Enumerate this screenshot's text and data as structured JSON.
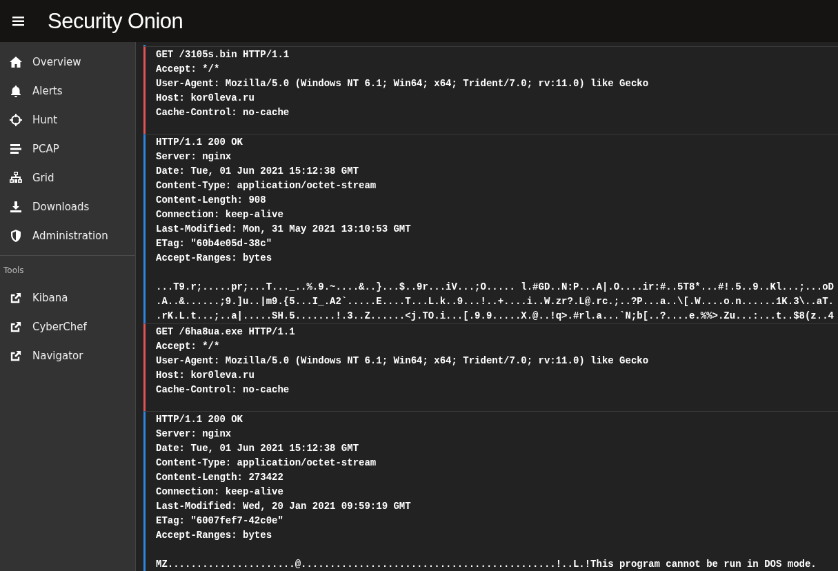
{
  "app": {
    "title": "Security Onion"
  },
  "nav": [
    {
      "label": "Overview"
    },
    {
      "label": "Alerts"
    },
    {
      "label": "Hunt"
    },
    {
      "label": "PCAP"
    },
    {
      "label": "Grid"
    },
    {
      "label": "Downloads"
    },
    {
      "label": "Administration"
    }
  ],
  "tools": {
    "heading": "Tools",
    "items": [
      {
        "label": "Kibana"
      },
      {
        "label": "CyberChef"
      },
      {
        "label": "Navigator"
      }
    ]
  },
  "stream": [
    {
      "kind": "response"
    },
    {
      "kind": "request",
      "headers": [
        "GET /3105s.bin HTTP/1.1",
        "Accept: */*",
        "User-Agent: Mozilla/5.0 (Windows NT 6.1; Win64; x64; Trident/7.0; rv:11.0) like Gecko",
        "Host: kor0leva.ru",
        "Cache-Control: no-cache"
      ]
    },
    {
      "kind": "response",
      "headers": [
        "HTTP/1.1 200 OK",
        "Server: nginx",
        "Date: Tue, 01 Jun 2021 15:12:38 GMT",
        "Content-Type: application/octet-stream",
        "Content-Length: 908",
        "Connection: keep-alive",
        "Last-Modified: Mon, 31 May 2021 13:10:53 GMT",
        "ETag: \"60b4e05d-38c\"",
        "Accept-Ranges: bytes"
      ],
      "body": [
        "...T9.r;.....pr;...T..._..%.9.~....&..}...$..9r...iV...;O..... l.#GD..N:P...A|.O....ir:#..5T8*...#!.5..9..Kl...;...oD",
        ".A..&......;9.]u..|m9.{5...I_.A2`.....E....T...L.k..9...!..+....i..W.zr?.L@.rc.;..?P...a..\\[.W....o.n......1K.3\\..aT.",
        ".rK.L.t...;..a|.....SH.5.......!.3..Z......<j.TO.i...[.9.9.....X.@..!q>.#rl.a...`N;b[..?....e.%%>.Zu...:...t..$8(z..4"
      ]
    },
    {
      "kind": "request",
      "headers": [
        "GET /6ha8ua.exe HTTP/1.1",
        "Accept: */*",
        "User-Agent: Mozilla/5.0 (Windows NT 6.1; Win64; x64; Trident/7.0; rv:11.0) like Gecko",
        "Host: kor0leva.ru",
        "Cache-Control: no-cache"
      ]
    },
    {
      "kind": "response",
      "headers": [
        "HTTP/1.1 200 OK",
        "Server: nginx",
        "Date: Tue, 01 Jun 2021 15:12:38 GMT",
        "Content-Type: application/octet-stream",
        "Content-Length: 273422",
        "Connection: keep-alive",
        "Last-Modified: Wed, 20 Jan 2021 09:59:19 GMT",
        "ETag: \"6007fef7-42c0e\"",
        "Accept-Ranges: bytes"
      ],
      "body": [
        "MZ......................@............................................!..L.!This program cannot be run in DOS mode."
      ]
    }
  ]
}
